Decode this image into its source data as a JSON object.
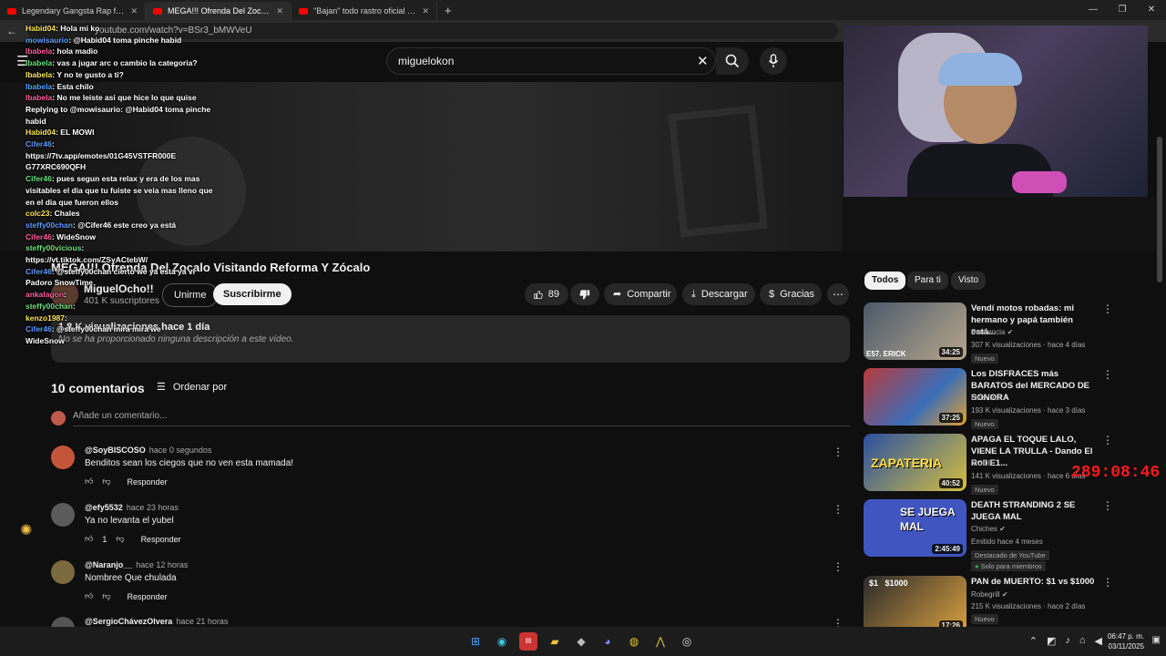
{
  "browser": {
    "tabs": [
      {
        "title": "Legendary Gangsta Rap from 90s",
        "active": false
      },
      {
        "title": "MEGA!!! Ofrenda Del Zocalo Visit",
        "active": true
      },
      {
        "title": "\"Bajan\" todo rastro oficial de la M",
        "active": false
      }
    ],
    "url": "youtube.com/watch?v=BSr3_bMWVeU"
  },
  "search": {
    "query": "miguelokon"
  },
  "video": {
    "title": "MEGA!!! Ofrenda Del Zocalo Visitando Reforma Y Zócalo",
    "channel": "MiguelOcho!!",
    "subscribers": "401 K suscriptores",
    "join_label": "Unirme",
    "subscribe_label": "Suscribirme",
    "likes": "89",
    "share_label": "Compartir",
    "download_label": "Descargar",
    "thanks_label": "Gracias",
    "meta": "1.8 K visualizaciones  hace 1 día",
    "description": "No se ha proporcionado ninguna descripción a este vídeo."
  },
  "comments": {
    "count_label": "10 comentarios",
    "sort_label": "Ordenar por",
    "placeholder": "Añade un comentario...",
    "reply_label": "Responder",
    "items": [
      {
        "author": "@SoyBISCOSO",
        "time": "hace 0 segundos",
        "text": "Benditos sean los ciegos que no ven esta mamada!",
        "likes": ""
      },
      {
        "author": "@efy5532",
        "time": "hace 23 horas",
        "text": "Ya no levanta el yubel",
        "likes": "1"
      },
      {
        "author": "@Naranjo__",
        "time": "hace 12 horas",
        "text": "Nombree Que chulada",
        "likes": ""
      },
      {
        "author": "@SergioChávezOlvera",
        "time": "hace 21 horas",
        "text": "",
        "likes": ""
      }
    ]
  },
  "chips": [
    "Todos",
    "Para ti",
    "Visto"
  ],
  "recommendations": [
    {
      "title": "Vendí motos robadas: mi hermano y papá también está...",
      "channel": "Penitencia",
      "views": "307 K visualizaciones · hace 4 días",
      "badge": "Nuevo",
      "duration": "34:25",
      "thumb_text": "E57. ERICK"
    },
    {
      "title": "Los DISFRACES más BARATOS del MERCADO DE SONORA",
      "channel": "LaloVillar",
      "views": "193 K visualizaciones · hace 3 días",
      "badge": "Nuevo",
      "duration": "37:25",
      "thumb_text": ""
    },
    {
      "title": "APAGA EL TOQUE LALO, VIENE LA TRULLA - Dando El Roll E1...",
      "channel": "MODE",
      "views": "141 K visualizaciones · hace 6 días",
      "badge": "Nuevo",
      "duration": "40:52",
      "thumb_text": "ZAPATERIA"
    },
    {
      "title": "DEATH STRANDING 2 SE JUEGA MAL",
      "channel": "Chiches",
      "views": "Emitido hace 4 meses",
      "badge": "Destacado de YouTube",
      "extra": "Solo para miembros",
      "duration": "2:45:49",
      "thumb_text": "SE JUEGA MAL"
    },
    {
      "title": "PAN de MUERTO: $1 vs $1000",
      "channel": "Robegrill",
      "views": "215 K visualizaciones · hace 2 días",
      "badge": "Nuevo",
      "duration": "17:26",
      "thumb_text": "$1   $1000"
    }
  ],
  "timer": "289:08:46",
  "chat": [
    {
      "user": "Habid04",
      "msg": "Hola mi ko"
    },
    {
      "user": "mowisaurio",
      "msg": "@Habid04 toma pinche habid"
    },
    {
      "user": "Ibabela",
      "msg": "hola madio"
    },
    {
      "user": "Ibabela",
      "msg": "vas a jugar arc o cambio la categoria?"
    },
    {
      "user": "Ibabela",
      "msg": "Y no te gusto a ti?"
    },
    {
      "user": "Ibabela",
      "msg": "Esta chilo"
    },
    {
      "user": "Ibabela",
      "msg": "No me leiste asi que hice lo que quise"
    },
    {
      "user": "",
      "msg": "Replying to @mowisaurio: @Habid04 toma pinche habid"
    },
    {
      "user": "Habid04",
      "msg": "EL MOWI"
    },
    {
      "user": "Cifer46",
      "msg": ""
    },
    {
      "user": "",
      "msg": "https://7tv.app/emotes/01G45VSTFR000E G77XRC690QFH"
    },
    {
      "user": "Cifer46",
      "msg": "pues segun esta relax y era de los mas visitables el dia que tu fuiste se veia mas lleno que en el dia que fueron ellos"
    },
    {
      "user": "colc23",
      "msg": "Chales"
    },
    {
      "user": "steffy00chan",
      "msg": "@Cifer46 este creo ya está"
    },
    {
      "user": "Cifer46",
      "msg": "WideSnow"
    },
    {
      "user": "steffy00vicious",
      "msg": ""
    },
    {
      "user": "",
      "msg": "https://vt.tiktok.com/ZSyACtebW/"
    },
    {
      "user": "Cifer46",
      "msg": "@steffy00chan cierto we ya esta ya vi Padoro SnowTime"
    },
    {
      "user": "ankalagon",
      "msg": ""
    },
    {
      "user": "steffy00chan",
      "msg": ""
    },
    {
      "user": "kenzo1987",
      "msg": ""
    },
    {
      "user": "Cifer46",
      "msg": "@steffy00chan mira mira we"
    },
    {
      "user": "",
      "msg": "WideSnow"
    }
  ],
  "taskbar": {
    "time": "06:47 p. m.",
    "date": "03/11/2025"
  }
}
